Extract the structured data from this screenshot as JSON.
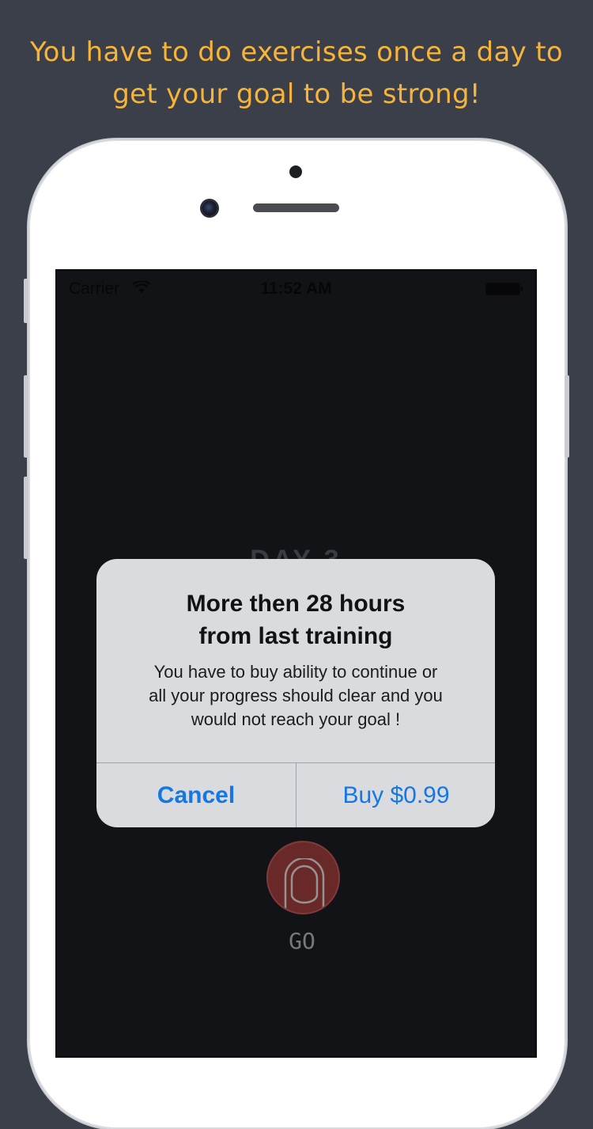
{
  "caption": {
    "line1": "You have to do exercises once  a day to",
    "line2": "get your goal to be strong!"
  },
  "status_bar": {
    "carrier": "Carrier",
    "time": "11:52 AM",
    "wifi_icon": "wifi-icon",
    "battery_icon": "battery-icon"
  },
  "screen": {
    "day_label": "DAY 3",
    "go_label": "GO",
    "go_icon": "finger-press-icon"
  },
  "alert": {
    "title_line1": "More then 28 hours",
    "title_line2": "from last training",
    "message_line1": "You have to buy ability to continue or",
    "message_line2": "all your progress should clear and you",
    "message_line3": "would not reach your goal !",
    "cancel_label": "Cancel",
    "buy_label": "Buy $0.99"
  },
  "colors": {
    "background": "#3a3f49",
    "caption": "#f6b43a",
    "screen": "#1c1e24",
    "go_button": "#a4403f",
    "alert_action": "#1477e6"
  }
}
